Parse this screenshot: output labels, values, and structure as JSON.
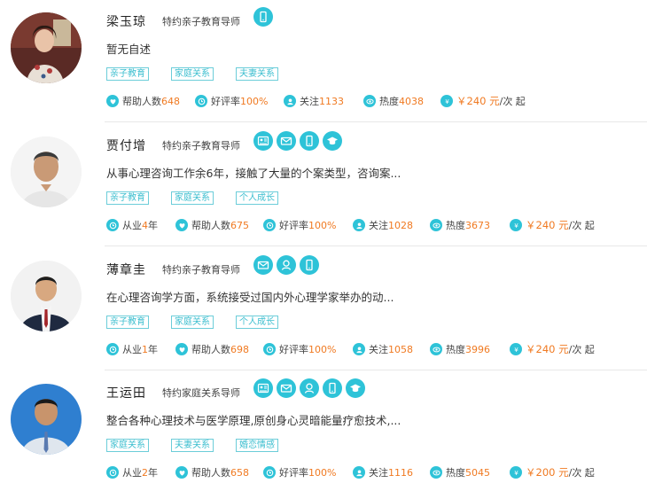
{
  "colors": {
    "accent": "#2ec3d8",
    "highlight": "#f07a22",
    "tag_border": "#6ccdd9"
  },
  "labels": {
    "help": "帮助人数",
    "rating": "好评率",
    "follow": "关注",
    "heat": "热度",
    "years": "从业",
    "year_unit": "年",
    "price_unit": "/次 起"
  },
  "counselors": [
    {
      "name": "梁玉琼",
      "title": "特约亲子教育导师",
      "services": [
        "phone-icon"
      ],
      "description": "暂无自述",
      "tags": [
        "亲子教育",
        "家庭关系",
        "夫妻关系"
      ],
      "years": "",
      "helped": "648",
      "rating": "100%",
      "followers": "1133",
      "heat": "4038",
      "price": "￥240 元"
    },
    {
      "name": "贾付增",
      "title": "特约亲子教育导师",
      "services": [
        "video-chat-icon",
        "mail-icon",
        "phone-icon",
        "graduation-cap-icon"
      ],
      "description": "从事心理咨询工作余6年，接触了大量的个案类型，咨询案...",
      "tags": [
        "亲子教育",
        "家庭关系",
        "个人成长"
      ],
      "years": "4",
      "helped": "675",
      "rating": "100%",
      "followers": "1028",
      "heat": "3673",
      "price": "￥240 元"
    },
    {
      "name": "薄章圭",
      "title": "特约亲子教育导师",
      "services": [
        "mail-icon",
        "user-icon",
        "phone-icon"
      ],
      "description": "在心理咨询学方面，系统接受过国内外心理学家举办的动...",
      "tags": [
        "亲子教育",
        "家庭关系",
        "个人成长"
      ],
      "years": "1",
      "helped": "698",
      "rating": "100%",
      "followers": "1058",
      "heat": "3996",
      "price": "￥240 元"
    },
    {
      "name": "王运田",
      "title": "特约家庭关系导师",
      "services": [
        "video-chat-icon",
        "mail-icon",
        "user-icon",
        "phone-icon",
        "graduation-cap-icon"
      ],
      "description": "整合各种心理技术与医学原理,原创身心灵暗能量疗愈技术,...",
      "tags": [
        "家庭关系",
        "夫妻关系",
        "婚恋情感"
      ],
      "years": "2",
      "helped": "658",
      "rating": "100%",
      "followers": "1116",
      "heat": "5045",
      "price": "￥200 元"
    }
  ]
}
